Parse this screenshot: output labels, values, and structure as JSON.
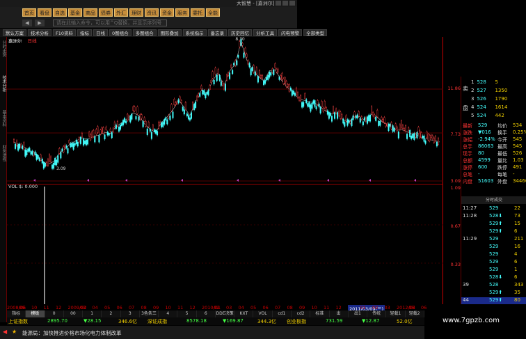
{
  "window": {
    "title": "大智慧 - [嘉洲尔]"
  },
  "logo_glyph": "♦",
  "toolbar1": [
    "首页",
    "看盘",
    "自选",
    "基金",
    "商品",
    "债券",
    "外汇",
    "理财",
    "资讯",
    "资金",
    "服务",
    "委托",
    "全能"
  ],
  "toolbar2": {
    "back": "◀",
    "fwd": "▶",
    "cmd_placeholder": "请在此输入命令，可以用^Q替换，并显示序列号"
  },
  "toolbar3": [
    "默认方案",
    "技术分析",
    "F10资料",
    "指标",
    "日线",
    "0图组合",
    "多图组合",
    "图形叠加",
    "系统指示",
    "备忘录",
    "历史回忆",
    "分析工具",
    "闪电预警",
    "全部类型"
  ],
  "vtabs": [
    "分时走势",
    "技术分析",
    "基本资料",
    "财务透视"
  ],
  "chart": {
    "stock": "嘉洲尔",
    "period": "日线",
    "sub_header": "VOL  $: 0.000",
    "low_label": "3.09",
    "peak_label": "8.30"
  },
  "chart_data": {
    "type": "line",
    "title": "嘉洲尔 日线",
    "xlabel": "",
    "ylabel": "",
    "ylim": [
      2,
      12
    ],
    "x": [
      0,
      4,
      8,
      12,
      16,
      20,
      24,
      28,
      32,
      36,
      40,
      44,
      48,
      52,
      56,
      60,
      64,
      68,
      72,
      76,
      80,
      84,
      88,
      92,
      96,
      100,
      104,
      108,
      112,
      116,
      120,
      124,
      128,
      132,
      136,
      140,
      144,
      148,
      152,
      156,
      160,
      164,
      168,
      172,
      176,
      180,
      184,
      188,
      192,
      196,
      200,
      204,
      208,
      212,
      216,
      220,
      224,
      228,
      232,
      236,
      240,
      244,
      248,
      252,
      256,
      260,
      264,
      268,
      272,
      276,
      280,
      284,
      288,
      292,
      296,
      300
    ],
    "series": [
      {
        "values": [
          4.7,
          4.5,
          4.3,
          4.0,
          3.8,
          3.3,
          3.1,
          3.3,
          3.9,
          4.2,
          4.6,
          4.8,
          5.0,
          4.9,
          5.1,
          5.2,
          5.4,
          5.3,
          5.8,
          6.1,
          6.4,
          6.8,
          6.6,
          6.0,
          5.6,
          5.4,
          6.1,
          6.5,
          7.0,
          7.7,
          7.2,
          6.6,
          7.6,
          8.4,
          8.2,
          9.1,
          9.7,
          8.7,
          9.8,
          10.3,
          11.9,
          10.6,
          9.9,
          9.4,
          9.1,
          9.8,
          9.9,
          9.2,
          8.7,
          8.3,
          7.9,
          7.7,
          7.6,
          7.5,
          7.2,
          6.9,
          6.7,
          6.8,
          6.3,
          6.1,
          6.6,
          6.5,
          6.2,
          6.7,
          6.5,
          6.1,
          5.9,
          5.7,
          5.6,
          5.5,
          5.3,
          5.2,
          5.0,
          4.9,
          4.8,
          4.7
        ]
      }
    ]
  },
  "yaxis": {
    "labels": [
      "11.86",
      "7.73",
      "3.09",
      "1.09",
      "0.67",
      "0.33"
    ]
  },
  "xaxis": {
    "labels": [
      "2008/06",
      "09",
      "10",
      "11",
      "12",
      "2009/02",
      "03",
      "04",
      "05",
      "06",
      "07",
      "08",
      "09",
      "10",
      "11",
      "12",
      "2010/01",
      "02",
      "03",
      "04",
      "05",
      "06",
      "07",
      "08",
      "09",
      "10",
      "11",
      "12",
      "2011/03/09(三)",
      "01",
      "02",
      "03",
      "2012/04",
      "05",
      "06"
    ],
    "highlight_index": 28
  },
  "order_book": {
    "side_sell": "卖",
    "side_buy": "盘",
    "rows": [
      {
        "n": "1",
        "p": "528",
        "v": "5"
      },
      {
        "n": "2",
        "p": "527",
        "v": "1350"
      },
      {
        "n": "3",
        "p": "526",
        "v": "1790"
      },
      {
        "n": "4",
        "p": "524",
        "v": "1614"
      },
      {
        "n": "5",
        "p": "524",
        "v": "442"
      }
    ]
  },
  "quote": [
    {
      "l1": "最新",
      "v1": "529",
      "l2": "均价",
      "v2": "534"
    },
    {
      "l1": "涨跌",
      "v1": "▼016",
      "l2": "换手",
      "v2": "0.25%"
    },
    {
      "l1": "涨幅",
      "v1": "-2.94%",
      "l2": "今开",
      "v2": "545"
    },
    {
      "l1": "总手",
      "v1": "86063",
      "l2": "最高",
      "v2": "545"
    },
    {
      "l1": "现手",
      "v1": "80",
      "l2": "最低",
      "v2": "526"
    },
    {
      "l1": "总额",
      "v1": "4599",
      "l2": "量比",
      "v2": "1.03"
    },
    {
      "l1": "涨停",
      "v1": "600",
      "l2": "跌停",
      "v2": "491"
    },
    {
      "l1": "总笔",
      "v1": "-",
      "l2": "每笔",
      "v2": "-"
    },
    {
      "l1": "内盘",
      "v1": "51603",
      "l2": "外盘",
      "v2": "34460"
    }
  ],
  "ticks_header": "分时成交",
  "ticks": [
    {
      "t": "11:27",
      "p": "529",
      "v": "22"
    },
    {
      "t": "11:28",
      "p": "528⬇",
      "v": "73"
    },
    {
      "t": "",
      "p": "529⬆",
      "v": "15"
    },
    {
      "t": "",
      "p": "529⬆",
      "v": "6"
    },
    {
      "t": "11:29",
      "p": "529",
      "v": "211"
    },
    {
      "t": "",
      "p": "529",
      "v": "16"
    },
    {
      "t": "",
      "p": "529",
      "v": "4"
    },
    {
      "t": "",
      "p": "529",
      "v": "6"
    },
    {
      "t": "",
      "p": "529",
      "v": "1"
    },
    {
      "t": "",
      "p": "528⬇",
      "v": "6"
    },
    {
      "t": "39",
      "p": "528",
      "v": "343"
    },
    {
      "t": "",
      "p": "529⬆",
      "v": "35"
    },
    {
      "t": "44",
      "p": "529⬆",
      "v": "80"
    }
  ],
  "indicator_strip": [
    "指标",
    "模板",
    "0",
    "00",
    "1",
    "2",
    "3",
    "3色条三线",
    "4",
    "5",
    "6",
    "DDE决策",
    "KXT",
    "VOL",
    "cd1",
    "cd2",
    "标准",
    "出",
    "出1",
    "传统",
    "轻载1",
    "轻载2"
  ],
  "index_bar": [
    {
      "label": "上证指数",
      "val": "2895.70",
      "chg": "▼28.15",
      "amt": "346.6亿"
    },
    {
      "label": "深证成指",
      "val": "8578.18",
      "chg": "▼169.87",
      "amt": "344.3亿"
    },
    {
      "label": "创业板指",
      "val": "731.59",
      "chg": "▼12.87",
      "amt": "52.0亿"
    }
  ],
  "news": {
    "text": "能源局：加快推进价格市场化电力体制改革"
  },
  "watermark": "www.7gpzb.com",
  "colors": {
    "up": "#ff3333",
    "down": "#00ffff",
    "accent": "#c78d3a",
    "grid": "#660000"
  }
}
